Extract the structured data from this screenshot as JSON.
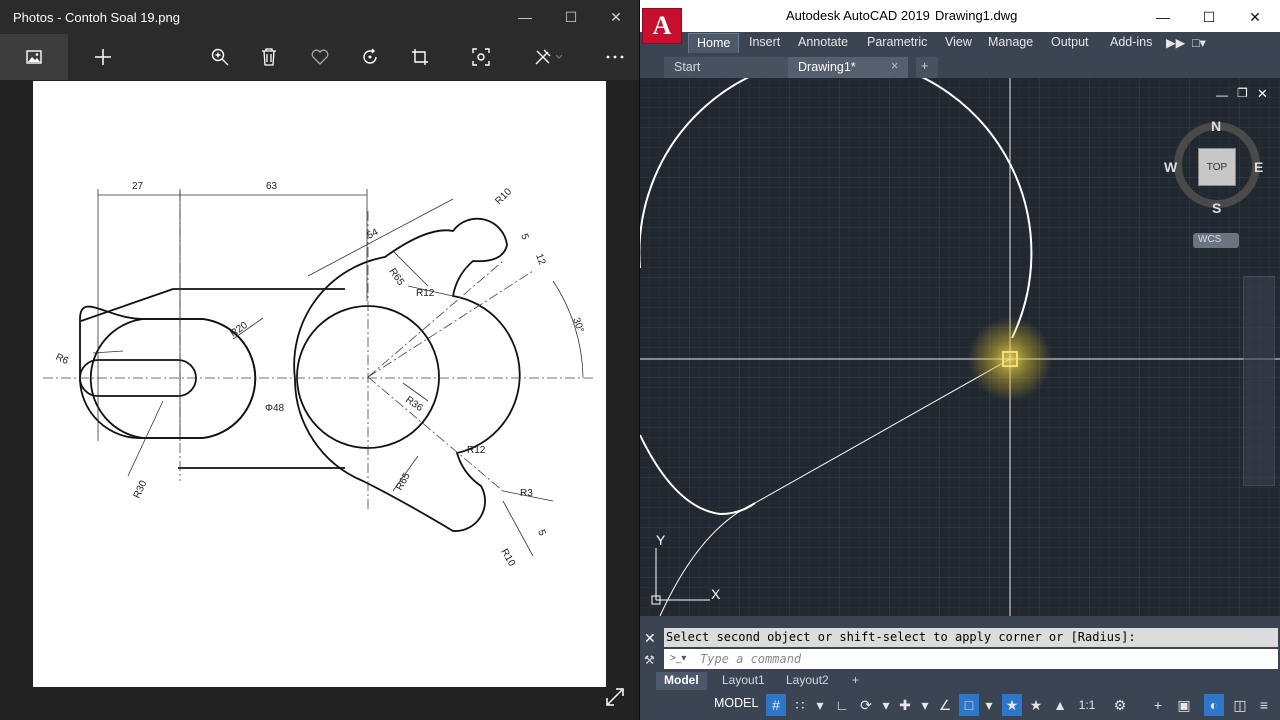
{
  "photos": {
    "window_title": "Photos - Contoh Soal 19.png",
    "toolbar": {
      "items": [
        "image-icon",
        "add-icon",
        "zoom-in-icon",
        "delete-icon",
        "favorite-icon",
        "rotate-icon",
        "crop-icon",
        "enhance-icon",
        "edit-icon",
        "more-icon"
      ]
    },
    "drawing": {
      "dim_27": "27",
      "dim_63": "63",
      "dim_54": "54",
      "r10_top": "R10",
      "dim_5_top": "5",
      "dim_12": "12",
      "angle_30": "30°",
      "r65_top": "R65",
      "r12_top": "R12",
      "r20": "R20",
      "r6": "R6",
      "phi48": "Φ48",
      "r36": "R36",
      "r12_bottom": "R12",
      "r65_bottom": "R65",
      "r30": "R30",
      "r3": "R3",
      "dim_5_bottom": "5",
      "r10_bottom": "R10"
    }
  },
  "acad": {
    "app_name": "Autodesk AutoCAD 2019",
    "file_name": "Drawing1.dwg",
    "logo_letter": "A",
    "ribbon_tabs": [
      "Home",
      "Insert",
      "Annotate",
      "Parametric",
      "View",
      "Manage",
      "Output",
      "Add-ins"
    ],
    "doc_tabs": [
      "Start",
      "Drawing1*"
    ],
    "viewcube": {
      "n": "N",
      "s": "S",
      "e": "E",
      "w": "W",
      "face": "TOP",
      "ucs": "WCS"
    },
    "ucs_icon": {
      "x": "X",
      "y": "Y"
    },
    "command_history": "Select second object or shift-select to apply corner or [Radius]:",
    "command_placeholder": "Type a command",
    "layout_tabs": [
      "Model",
      "Layout1",
      "Layout2"
    ],
    "status": {
      "model_label": "MODEL",
      "scale": "1:1"
    }
  }
}
